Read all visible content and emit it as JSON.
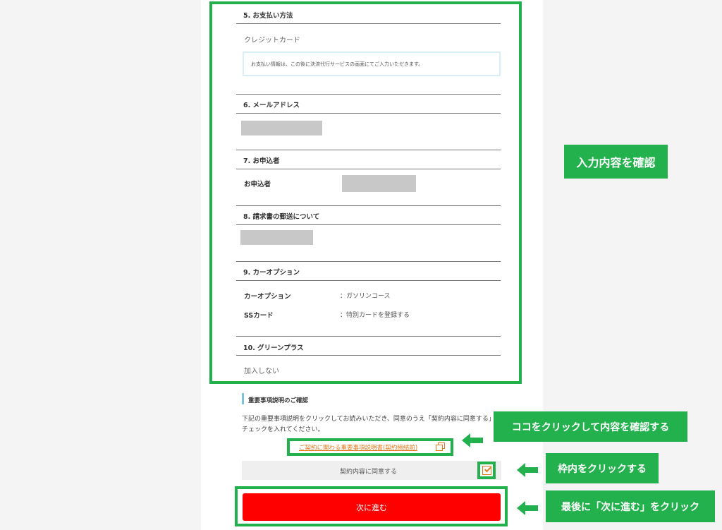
{
  "sections": {
    "payment": {
      "title": "5. お支払い方法",
      "value": "クレジットカード",
      "notice": "お支払い情報は、この後に決済代行サービスの画面にてご入力いただきます。"
    },
    "email": {
      "title": "6. メールアドレス"
    },
    "applicant": {
      "title": "7. お申込者",
      "label": "お申込者"
    },
    "invoice": {
      "title": "8. 請求書の郵送について"
    },
    "car_option": {
      "title": "9. カーオプション",
      "rows": [
        {
          "label": "カーオプション",
          "value": "：ガソリンコース"
        },
        {
          "label": "SSカード",
          "value": "：特別カードを登録する"
        }
      ]
    },
    "green_plus": {
      "title": "10. グリーンプラス",
      "value": "加入しない"
    }
  },
  "important": {
    "title": "重要事項説明のご確認",
    "description": "下記の重要事項説明をクリックしてお読みいただき、同意のうえ「契約内容に同意する」にチェックを入れてください。",
    "link": "ご契約に関わる重要事項説明書(契約締結前)",
    "agree_label": "契約内容に同意する",
    "agree_checked": true
  },
  "next_button": "次に進む",
  "callouts": {
    "confirm_input": "入力内容を確認",
    "click_link": "ココをクリックして内容を確認する",
    "click_box": "枠内をクリックする",
    "click_next": "最後に「次に進む」をクリック"
  },
  "colors": {
    "highlight_green": "#22b14c",
    "next_button_red": "#ff0000",
    "link_orange": "#e07a1f"
  }
}
